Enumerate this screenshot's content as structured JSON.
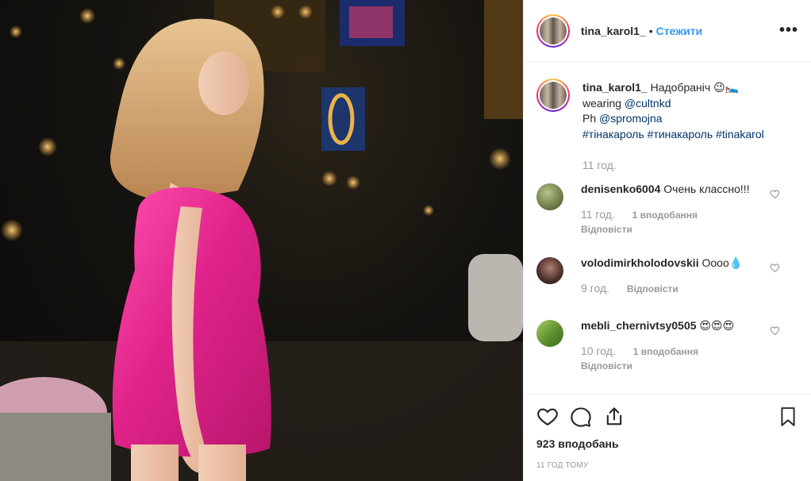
{
  "post": {
    "username": "tina_karol1_",
    "follow_label": "Стежити",
    "more_label": "•••"
  },
  "caption": {
    "username": "tina_karol1_",
    "text_line1": "Надобраніч 😉🛌",
    "wearing_prefix": "wearing ",
    "wearing_mention": "@cultnkd",
    "ph_prefix": "Ph ",
    "ph_mention": "@spromojna",
    "hashtags": "#тінакароль #тинакароль #tinakarol",
    "time": "11 год."
  },
  "comments": [
    {
      "username": "denisenko6004",
      "text": "Очень классно!!!",
      "time": "11 год.",
      "likes": "1 вподобання",
      "reply": "Відповісти",
      "avatar_color": "#7a8a5a"
    },
    {
      "username": "volodimirkholodovskii",
      "text": "Оооо💧",
      "time": "9 год.",
      "likes": "",
      "reply": "Відповісти",
      "avatar_color": "#4a2f2a"
    },
    {
      "username": "mebli_chernivtsy0505",
      "text": "😍😍😍",
      "time": "10 год.",
      "likes": "1 вподобання",
      "reply": "Відповісти",
      "avatar_color": "#6f9a3a"
    }
  ],
  "actions": {
    "like_count": "923 вподобань",
    "post_time": "11 ГОД ТОМУ"
  },
  "colors": {
    "follow_blue": "#3897f0",
    "mention_blue": "#003569",
    "muted": "#999999",
    "dress_pink": "#e8268a"
  }
}
